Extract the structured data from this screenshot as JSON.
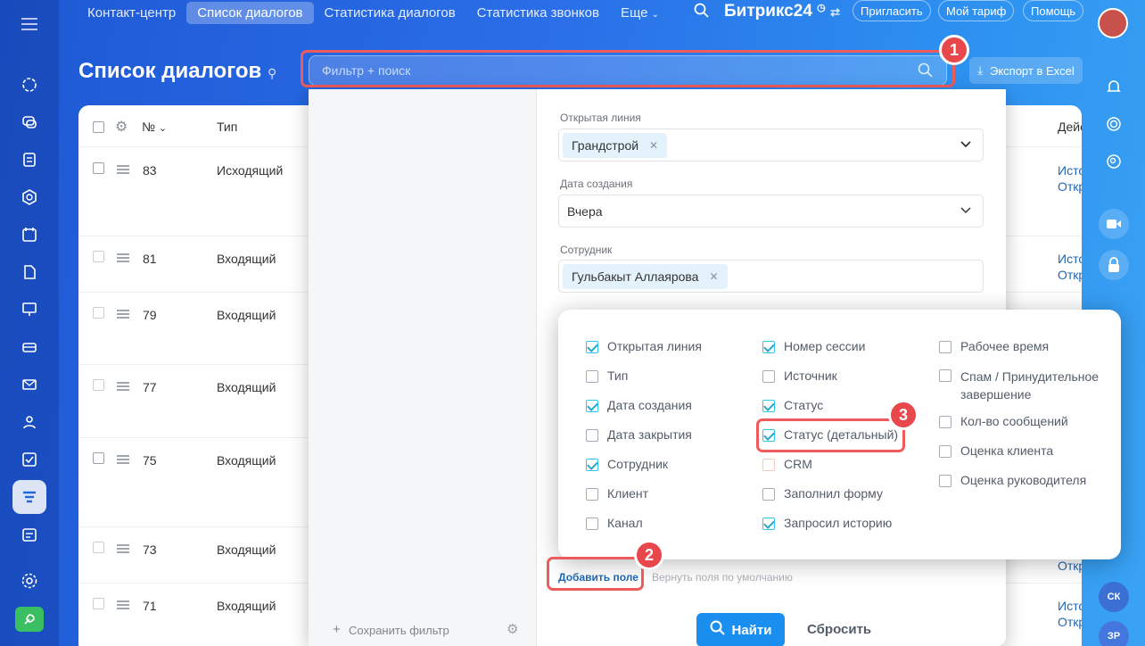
{
  "topnav": {
    "tabs": [
      {
        "label": "Контакт-центр",
        "active": false
      },
      {
        "label": "Список диалогов",
        "active": true
      },
      {
        "label": "Статистика диалогов",
        "active": false
      },
      {
        "label": "Статистика звонков",
        "active": false
      },
      {
        "label": "Еще",
        "active": false
      }
    ],
    "logo_text": "Битрикс24",
    "buttons": {
      "invite": "Пригласить",
      "tariff": "Мой тариф",
      "help": "Помощь"
    }
  },
  "page": {
    "title": "Список диалогов",
    "export_label": "Экспорт в Excel"
  },
  "filter": {
    "placeholder": "Фильтр + поиск"
  },
  "grid": {
    "headers": {
      "num": "№",
      "type": "Тип",
      "actions": "Дейс"
    },
    "rows": [
      {
        "num": "83",
        "type": "Исходящий",
        "action1": "Исто",
        "action2": "Откр"
      },
      {
        "num": "81",
        "type": "Входящий",
        "action1": "Исто",
        "action2": "Откр"
      },
      {
        "num": "79",
        "type": "Входящий",
        "action1": "",
        "action2": ""
      },
      {
        "num": "77",
        "type": "Входящий",
        "action1": "",
        "action2": ""
      },
      {
        "num": "75",
        "type": "Входящий",
        "action1": "",
        "action2": ""
      },
      {
        "num": "73",
        "type": "Входящий",
        "action1": "",
        "action2": "Откр"
      },
      {
        "num": "71",
        "type": "Входящий",
        "action1": "Исто",
        "action2": "Откр"
      }
    ]
  },
  "panel": {
    "fields": [
      {
        "label": "Открытая линия",
        "value": "Грандстрой",
        "type": "tag"
      },
      {
        "label": "Дата создания",
        "value": "Вчера",
        "type": "select"
      },
      {
        "label": "Сотрудник",
        "value": "Гульбакыт Аллаярова",
        "type": "tag"
      }
    ],
    "save_filter": "Сохранить фильтр",
    "add_field": "Добавить поле",
    "restore_defaults": "Вернуть поля по умолчанию",
    "find": "Найти",
    "reset": "Сбросить"
  },
  "popup": {
    "col1": [
      {
        "label": "Открытая линия",
        "checked": true
      },
      {
        "label": "Тип",
        "checked": false
      },
      {
        "label": "Дата создания",
        "checked": true
      },
      {
        "label": "Дата закрытия",
        "checked": false
      },
      {
        "label": "Сотрудник",
        "checked": true
      },
      {
        "label": "Клиент",
        "checked": false
      },
      {
        "label": "Канал",
        "checked": false
      }
    ],
    "col2": [
      {
        "label": "Номер сессии",
        "checked": true
      },
      {
        "label": "Источник",
        "checked": false
      },
      {
        "label": "Статус",
        "checked": true
      },
      {
        "label": "Статус (детальный)",
        "checked": true
      },
      {
        "label": "CRM",
        "checked": false
      },
      {
        "label": "Заполнил форму",
        "checked": false
      },
      {
        "label": "Запросил историю",
        "checked": true
      }
    ],
    "col3": [
      {
        "label": "Рабочее время",
        "checked": false
      },
      {
        "label": "Спам / Принудительное завершение",
        "checked": false
      },
      {
        "label": "Кол-во сообщений",
        "checked": false
      },
      {
        "label": "Оценка клиента",
        "checked": false
      },
      {
        "label": "Оценка руководителя",
        "checked": false
      }
    ]
  },
  "annotations": {
    "badge1": "1",
    "badge2": "2",
    "badge3": "3"
  },
  "right_bar": {
    "initials1": "СК",
    "initials2": "ЗР"
  },
  "colors": {
    "accent": "#1a8ff0",
    "highlight": "#e8474b",
    "check": "#2aa7c9"
  }
}
